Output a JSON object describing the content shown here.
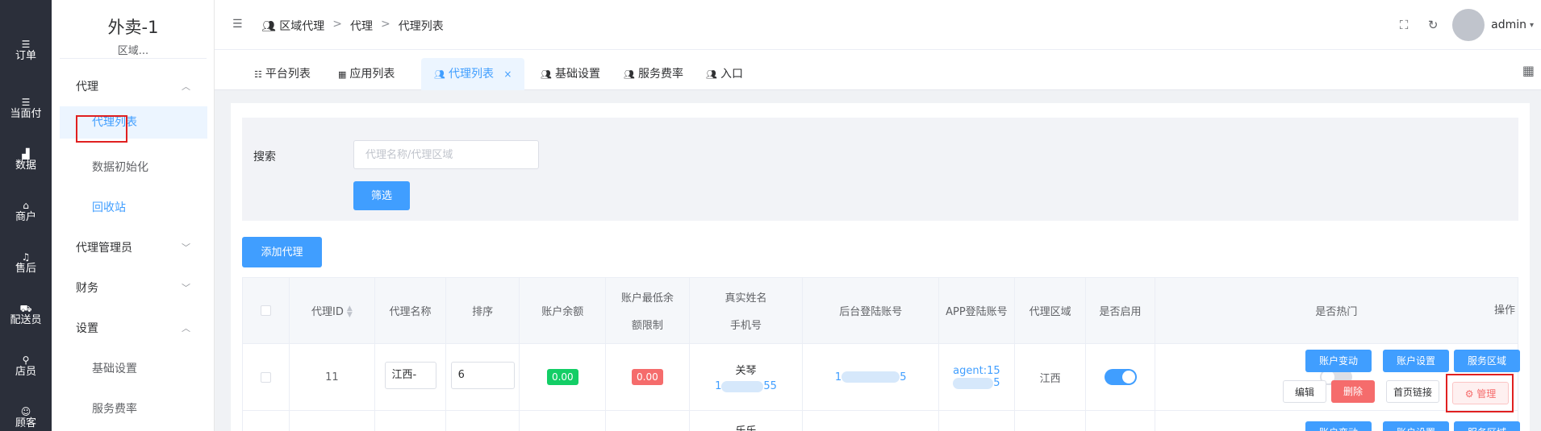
{
  "rail": [
    {
      "icon": "list-icon",
      "glyph": "☰",
      "label": "订单"
    },
    {
      "icon": "list-icon",
      "glyph": "☰",
      "label": "当面付"
    },
    {
      "icon": "bar-chart-icon",
      "glyph": "▟",
      "label": "数据"
    },
    {
      "icon": "shop-icon",
      "glyph": "⌂",
      "label": "商户"
    },
    {
      "icon": "headset-icon",
      "glyph": "♫",
      "label": "售后"
    },
    {
      "icon": "courier-icon",
      "glyph": "⛟",
      "label": "配送员"
    },
    {
      "icon": "user-search-icon",
      "glyph": "⚲",
      "label": "店员"
    },
    {
      "icon": "customer-icon",
      "glyph": "☺",
      "label": "顾客"
    }
  ],
  "brand": {
    "title": "外卖-1",
    "subtitle": "区域..."
  },
  "menu": {
    "group_agent": "代理",
    "agent_list": "代理列表",
    "data_init": "数据初始化",
    "recycle": "回收站",
    "group_admin": "代理管理员",
    "group_finance": "财务",
    "group_settings": "设置",
    "basic_settings": "基础设置",
    "service_fee": "服务费率"
  },
  "breadcrumb": {
    "root": "区域代理",
    "sep": ">",
    "mid": "代理",
    "leaf": "代理列表"
  },
  "user": {
    "name": "admin"
  },
  "tabs": {
    "platform": "平台列表",
    "apps": "应用列表",
    "agents": "代理列表",
    "basic": "基础设置",
    "fee": "服务费率",
    "entry": "入口"
  },
  "filter": {
    "label": "搜索",
    "placeholder": "代理名称/代理区域",
    "button": "筛选"
  },
  "add_button": "添加代理",
  "table": {
    "headers": {
      "id": "代理ID",
      "name": "代理名称",
      "sort": "排序",
      "balance": "账户余额",
      "min_balance_1": "账户最低余",
      "min_balance_2": "额限制",
      "real_name": "真实姓名",
      "phone": "手机号",
      "backend_account": "后台登陆账号",
      "app_account": "APP登陆账号",
      "region": "代理区域",
      "enabled": "是否启用",
      "hot": "是否热门",
      "actions": "操作"
    },
    "row": {
      "id": "11",
      "name": "江西-",
      "sort": "6",
      "balance": "0.00",
      "min_balance": "0.00",
      "real_name": "关琴",
      "phone_prefix": "1",
      "phone_suffix": "55",
      "backend_prefix": "1",
      "backend_suffix": "5",
      "app_prefix": "agent:15",
      "app_suffix": "5",
      "region": "江西",
      "enabled": true,
      "hot": false
    },
    "row2": {
      "real_name": "乐乐"
    },
    "actions": {
      "account_change": "账户变动",
      "account_settings": "账户设置",
      "service_area": "服务区域",
      "edit": "编辑",
      "delete": "删除",
      "home_link": "首页链接",
      "manage": "管理"
    }
  }
}
